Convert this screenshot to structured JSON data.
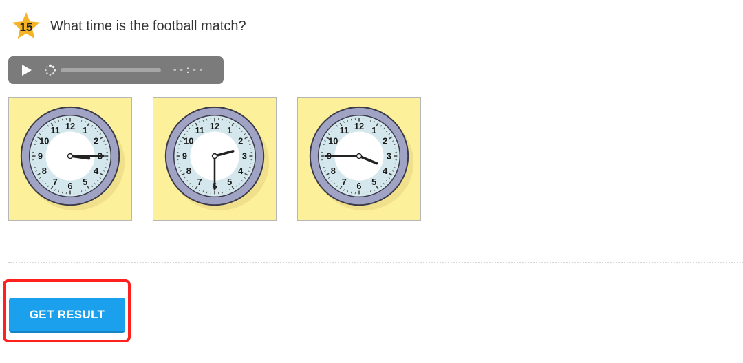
{
  "question": {
    "number": "15",
    "text": "What time is the football match?"
  },
  "audio_player": {
    "time_display": "--:--"
  },
  "options": [
    {
      "hour": 3,
      "minute": 15,
      "time": "3:15"
    },
    {
      "hour": 2,
      "minute": 30,
      "time": "2:30"
    },
    {
      "hour": 3,
      "minute": 45,
      "time": "3:45"
    }
  ],
  "submit_button": {
    "label": "GET RESULT"
  },
  "colors": {
    "star": "#f5b326",
    "clock_card": "#fdf09b",
    "audio_bar": "#7b7b7b",
    "button": "#1aa0ec",
    "highlight": "#ff2020"
  }
}
